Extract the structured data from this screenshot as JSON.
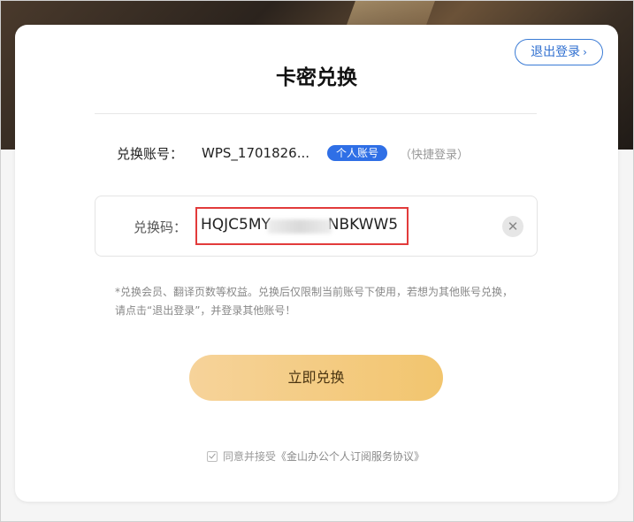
{
  "header": {
    "title": "卡密兑换",
    "logout_label": "退出登录",
    "logout_chevron": "›"
  },
  "account": {
    "label": "兑换账号：",
    "value": "WPS_1701826...",
    "badge": "个人账号",
    "quick_login": "（快捷登录）"
  },
  "code": {
    "label": "兑换码：",
    "value": "HQJC5MY            NBKWW5",
    "clear_icon": "close-icon"
  },
  "note": {
    "line1": "*兑换会员、翻译页数等权益。兑换后仅限制当前账号下使用，若想为其他账号兑换，",
    "line2": "请点击“退出登录”，并登录其他账号！"
  },
  "redeem_button": "立即兑换",
  "agreement": {
    "checked": true,
    "prefix": "同意并接受",
    "link": "《金山办公个人订阅服务协议》"
  },
  "colors": {
    "accent": "#2f6fe6",
    "button_gold": "#f2c56e",
    "highlight_border": "#e23b3b"
  }
}
